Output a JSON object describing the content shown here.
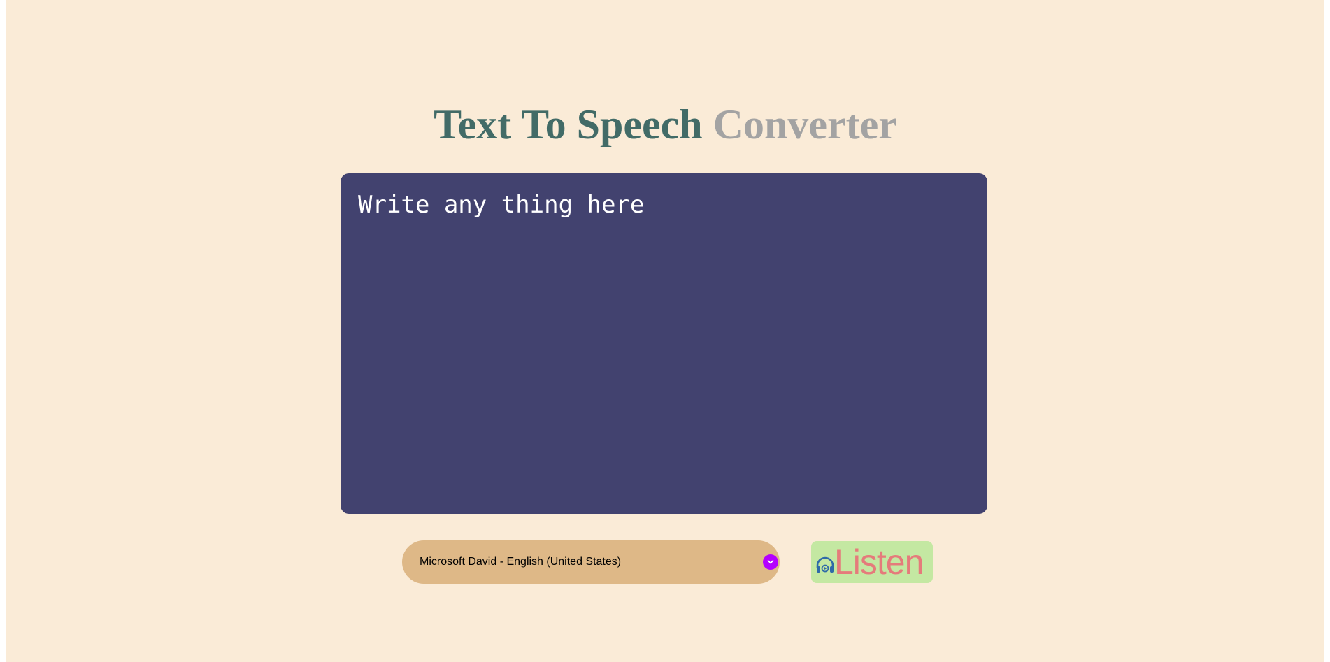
{
  "header": {
    "title_main": "Text To Speech",
    "title_accent": "Converter"
  },
  "editor": {
    "placeholder": "Write any thing here",
    "value": ""
  },
  "controls": {
    "voice_selected": "Microsoft David - English (United States)",
    "voice_chevron_icon": "chevron-down-icon",
    "listen_label": "Listen",
    "listen_icon": "headphones-icon"
  },
  "colors": {
    "background": "#faebd7",
    "title_main": "#426b67",
    "title_accent": "#a3a3a3",
    "editor_bg": "#42426f",
    "select_bg": "#deb887",
    "chevron_bg": "#b400ff",
    "button_bg": "#c4e8a2",
    "button_text": "#e57b7b"
  }
}
